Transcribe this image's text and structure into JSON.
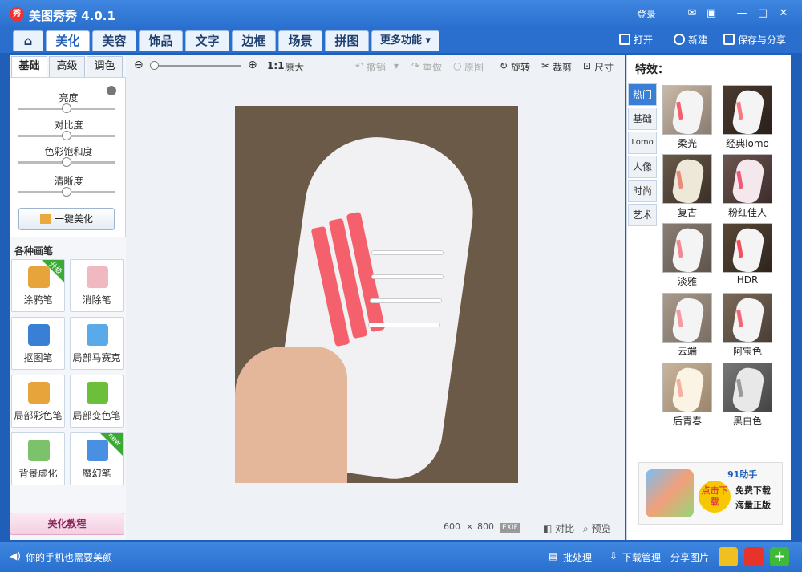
{
  "app": {
    "title": "美图秀秀 4.0.1",
    "logo": "秀",
    "login": "登录"
  },
  "window_controls": [
    "chat-icon",
    "skin-icon",
    "minimize-icon",
    "maximize-icon",
    "close-icon"
  ],
  "tabs": [
    {
      "label": "美化",
      "active": true
    },
    {
      "label": "美容"
    },
    {
      "label": "饰品"
    },
    {
      "label": "文字"
    },
    {
      "label": "边框"
    },
    {
      "label": "场景"
    },
    {
      "label": "拼图"
    },
    {
      "label": "更多功能 ▾"
    }
  ],
  "file_actions": {
    "open": "打开",
    "new": "新建",
    "save": "保存与分享"
  },
  "sub_tabs": [
    "基础",
    "高级",
    "调色"
  ],
  "adjustments": [
    {
      "label": "亮度",
      "value": 0.5
    },
    {
      "label": "对比度",
      "value": 0.5
    },
    {
      "label": "色彩饱和度",
      "value": 0.5
    },
    {
      "label": "清晰度",
      "value": 0.5
    }
  ],
  "one_key": "一键美化",
  "brushes_title": "各种画笔",
  "brushes": [
    {
      "label": "涂鸦笔",
      "badge": "升级",
      "color": "#e6a43a"
    },
    {
      "label": "消除笔",
      "badge": "",
      "color": "#f0b8c0"
    },
    {
      "label": "抠图笔",
      "badge": "",
      "color": "#3a7fd6"
    },
    {
      "label": "局部马赛克",
      "badge": "",
      "color": "#5aa9e8"
    },
    {
      "label": "局部彩色笔",
      "badge": "",
      "color": "#e6a43a"
    },
    {
      "label": "局部变色笔",
      "badge": "",
      "color": "#6cbf3a"
    },
    {
      "label": "背景虚化",
      "badge": "",
      "color": "#7cc26a"
    },
    {
      "label": "魔幻笔",
      "badge": "new",
      "color": "#4a90e2"
    }
  ],
  "tutorial": "美化教程",
  "toolbar": {
    "zoom_ratio": "1:1",
    "original_size": "原大",
    "undo": "撤销",
    "redo": "重做",
    "original": "原图",
    "rotate": "旋转",
    "crop": "裁剪",
    "resize": "尺寸"
  },
  "image_info": {
    "width": "600",
    "times": "×",
    "height": "800",
    "exif": "EXIF",
    "compare": "对比",
    "preview": "预览"
  },
  "effects_title": "特效：",
  "effect_categories": [
    {
      "label": "热门",
      "active": true
    },
    {
      "label": "基础"
    },
    {
      "label": "Lomo"
    },
    {
      "label": "人像"
    },
    {
      "label": "时尚"
    },
    {
      "label": "艺术"
    }
  ],
  "effects": [
    {
      "label": "柔光"
    },
    {
      "label": "经典lomo"
    },
    {
      "label": "复古"
    },
    {
      "label": "粉红佳人"
    },
    {
      "label": "淡雅"
    },
    {
      "label": "HDR"
    },
    {
      "label": "云端"
    },
    {
      "label": "阿宝色"
    },
    {
      "label": "后青春"
    },
    {
      "label": "黑白色"
    }
  ],
  "ad": {
    "brand": "91助手",
    "button": "点击下载",
    "line1": "免费下载",
    "line2": "海量正版"
  },
  "statusbar": {
    "tip": "你的手机也需要美颜",
    "batch": "批处理",
    "download": "下载管理",
    "share": "分享图片"
  },
  "colors": {
    "accent": "#2a6fce",
    "stripe": "#f4606c",
    "active_category": "#3a7fd6"
  }
}
